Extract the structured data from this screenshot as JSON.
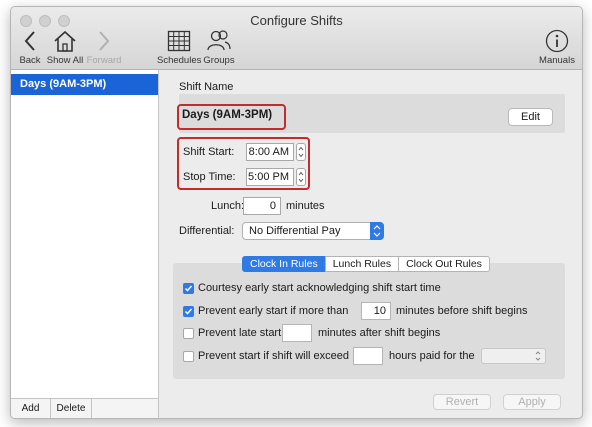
{
  "window": {
    "title": "Configure Shifts"
  },
  "toolbar": {
    "back_label": "Back",
    "show_all_label": "Show All",
    "forward_label": "Forward",
    "schedules_label": "Schedules",
    "groups_label": "Groups",
    "manuals_label": "Manuals"
  },
  "sidebar": {
    "items": [
      {
        "label": "Days (9AM-3PM)",
        "selected": true
      }
    ],
    "add_label": "Add",
    "delete_label": "Delete"
  },
  "shift": {
    "section_label": "Shift Name",
    "name": "Days (9AM-3PM)",
    "edit_label": "Edit",
    "start_label": "Shift Start:",
    "start_value": "8:00 AM",
    "stop_label": "Stop Time:",
    "stop_value": "5:00 PM",
    "lunch_label": "Lunch:",
    "lunch_value": "0",
    "lunch_unit": "minutes",
    "differential_label": "Differential:",
    "differential_value": "No Differential Pay"
  },
  "tabs": {
    "clock_in": "Clock In Rules",
    "lunch": "Lunch Rules",
    "clock_out": "Clock Out Rules",
    "active": "Clock In Rules"
  },
  "rules": {
    "courtesy": {
      "label": "Courtesy early start acknowledging shift start time",
      "checked": true
    },
    "prevent_early": {
      "label": "Prevent early start if more than",
      "value": "10",
      "suffix": "minutes before shift begins",
      "checked": true
    },
    "prevent_late": {
      "label": "Prevent late start",
      "value": "",
      "suffix": "minutes after shift begins",
      "checked": false
    },
    "prevent_exceed": {
      "label": "Prevent start if shift will exceed",
      "value": "",
      "suffix": "hours paid for the",
      "checked": false
    }
  },
  "footer": {
    "revert_label": "Revert",
    "apply_label": "Apply"
  },
  "colors": {
    "accent": "#2f7ae5",
    "selection": "#1a64d8",
    "highlight": "#c42b2b"
  }
}
